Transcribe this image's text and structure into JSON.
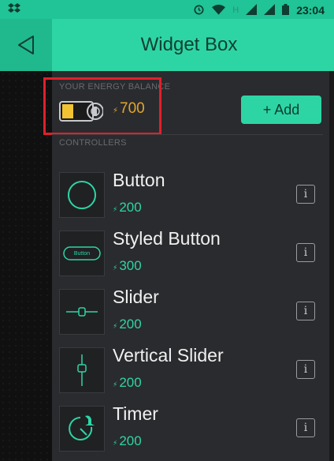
{
  "status_bar": {
    "time": "23:04",
    "left_icon": "dropbox-icon",
    "icons": [
      "alarm-icon",
      "wifi-icon",
      "signal-h-icon",
      "signal-icon",
      "battery-icon"
    ]
  },
  "header": {
    "title": "Widget Box",
    "back_icon": "back-arrow-icon"
  },
  "energy": {
    "label": "YOUR ENERGY BALANCE",
    "value": "700",
    "currency_symbol": "⚡"
  },
  "add_button": {
    "label": "+ Add"
  },
  "controllers": {
    "label": "CONTROLLERS",
    "items": [
      {
        "name": "Button",
        "cost": "200",
        "icon": "circle-button-icon"
      },
      {
        "name": "Styled Button",
        "cost": "300",
        "icon": "styled-button-icon",
        "icon_text": "Button"
      },
      {
        "name": "Slider",
        "cost": "200",
        "icon": "slider-icon"
      },
      {
        "name": "Vertical Slider",
        "cost": "200",
        "icon": "vertical-slider-icon"
      },
      {
        "name": "Timer",
        "cost": "200",
        "icon": "timer-icon"
      }
    ]
  },
  "colors": {
    "accent": "#2dd5a5",
    "header_dark": "#20b98e",
    "energy_value": "#e3a62a",
    "highlight_border": "#e2202a",
    "panel": "#2a2b2e"
  }
}
